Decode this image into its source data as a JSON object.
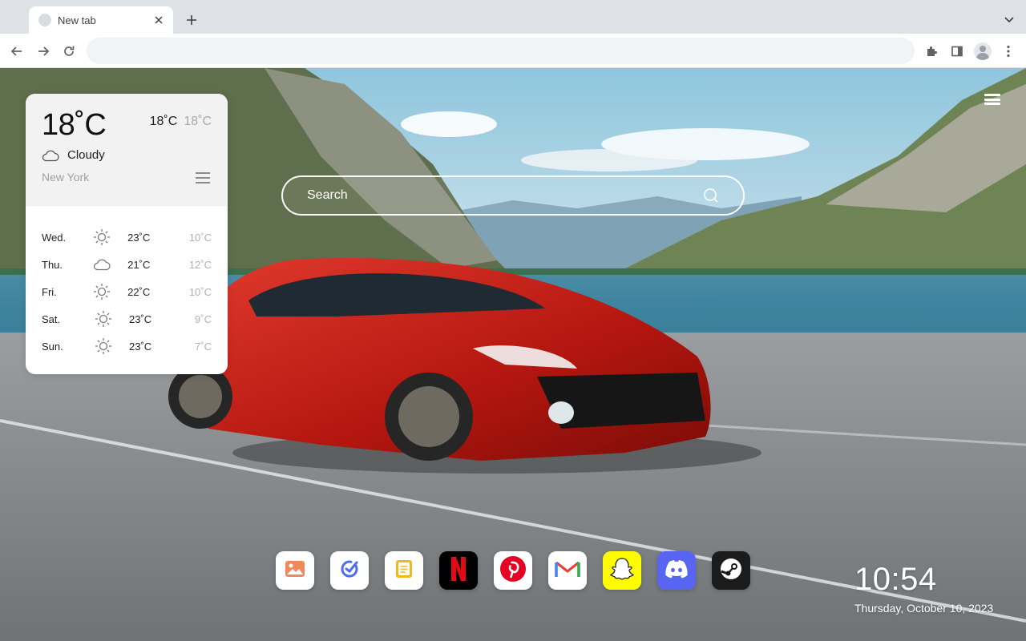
{
  "browser": {
    "tab": {
      "title": "New tab"
    },
    "omnibox": {
      "value": "",
      "placeholder": ""
    }
  },
  "search": {
    "placeholder": "Search"
  },
  "weather": {
    "current": {
      "temp": "18˚C",
      "high": "18˚C",
      "low": "18˚C",
      "condition": "Cloudy",
      "city": "New York",
      "icon": "cloud-icon"
    },
    "forecast": [
      {
        "day": "Wed.",
        "icon": "sun-icon",
        "high": "23˚C",
        "low": "10˚C"
      },
      {
        "day": "Thu.",
        "icon": "cloud-icon",
        "high": "21˚C",
        "low": "12˚C"
      },
      {
        "day": "Fri.",
        "icon": "sun-icon",
        "high": "22˚C",
        "low": "10˚C"
      },
      {
        "day": "Sat.",
        "icon": "sun-icon",
        "high": "23˚C",
        "low": "9˚C"
      },
      {
        "day": "Sun.",
        "icon": "sun-icon",
        "high": "23˚C",
        "low": "7˚C"
      }
    ]
  },
  "dock": {
    "apps": [
      {
        "name": "photos",
        "icon": "photos-icon",
        "bg": "#ffffff",
        "color": "#f08a5d"
      },
      {
        "name": "tasks",
        "icon": "check-icon",
        "bg": "#ffffff",
        "color": "#4a6cf7"
      },
      {
        "name": "notes",
        "icon": "notes-icon",
        "bg": "#ffffff",
        "color": "#f2b81d"
      },
      {
        "name": "netflix",
        "icon": "netflix-icon",
        "bg": "#000000",
        "color": "#e50914"
      },
      {
        "name": "pinterest",
        "icon": "pinterest-icon",
        "bg": "#ffffff",
        "color": "#e60023"
      },
      {
        "name": "gmail",
        "icon": "gmail-icon",
        "bg": "#ffffff",
        "color": "#ea4335"
      },
      {
        "name": "snapchat",
        "icon": "snapchat-icon",
        "bg": "#fffc00",
        "color": "#ffffff"
      },
      {
        "name": "discord",
        "icon": "discord-icon",
        "bg": "#5865f2",
        "color": "#ffffff"
      },
      {
        "name": "steam",
        "icon": "steam-icon",
        "bg": "#1b1b1b",
        "color": "#ffffff"
      }
    ]
  },
  "clock": {
    "time": "10:54",
    "date": "Thursday, October 10, 2023"
  }
}
